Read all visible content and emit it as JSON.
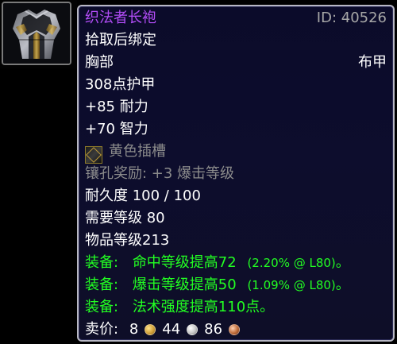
{
  "item": {
    "name": "织法者长袍",
    "id_label": "ID: 40526",
    "bind": "拾取后绑定",
    "slot": "胸部",
    "armor_type": "布甲",
    "armor": "308点护甲",
    "stats": [
      "+85 耐力",
      "+70 智力"
    ],
    "socket": {
      "label": "黄色插槽",
      "bonus": "镶孔奖励: +3 爆击等级"
    },
    "durability": "耐久度 100 / 100",
    "required_level": "需要等级 80",
    "item_level": "物品等级213",
    "equips": [
      {
        "prefix": "装备:",
        "text": "命中等级提高72",
        "paren": "(2.20% @ L80)",
        "tail": "。"
      },
      {
        "prefix": "装备:",
        "text": "爆击等级提高50",
        "paren": "(1.09% @ L80)",
        "tail": "。"
      },
      {
        "prefix": "装备:",
        "text": "法术强度提高110点。",
        "paren": "",
        "tail": ""
      }
    ],
    "sell": {
      "label": "卖价:",
      "gold": "8",
      "silver": "44",
      "copper": "86"
    }
  },
  "colors": {
    "epic_purple": "#b14cf5",
    "equip_green": "#22ff22",
    "muted_gray": "#8b8b8b",
    "text_white": "#ffffff"
  },
  "icons": {
    "item": "cloth-robe-icon",
    "socket": "yellow-socket-icon",
    "gold": "gold-coin-icon",
    "silver": "silver-coin-icon",
    "copper": "copper-coin-icon"
  }
}
